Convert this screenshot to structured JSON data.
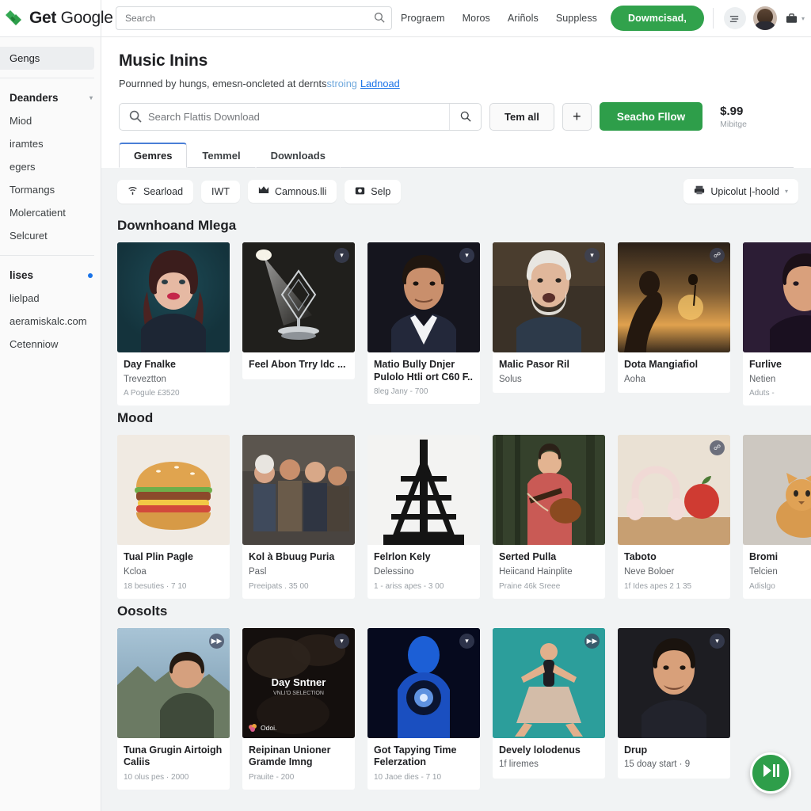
{
  "header": {
    "brand_bold": "Get",
    "brand_light": "Google",
    "logo_icon": "green-diamond-logo-icon",
    "search": {
      "placeholder": "Search",
      "value": "",
      "icon": "search-icon"
    },
    "nav": [
      {
        "label": "Prograem"
      },
      {
        "label": "Moros"
      },
      {
        "label": "Ariñols"
      },
      {
        "label": "Suppless"
      }
    ],
    "download_button": "Dowmcisad,",
    "list_icon": "lines-list-icon",
    "avatar": "user-avatar",
    "apps_icon": "briefcase-icon",
    "caret_icon": "chevron-down-icon"
  },
  "sidebar": {
    "active_item": "Gengs",
    "groups": [
      {
        "title": "Deanders",
        "caret": "chevron-down-icon",
        "items": [
          "Miod",
          "iramtes",
          "egers",
          "Tormangs",
          "Molercatient",
          "Selcuret"
        ]
      },
      {
        "title": "lises",
        "badge": "blue-dot",
        "items": [
          "lielpad",
          "aeramiskalc.com",
          "Cetenniow"
        ]
      }
    ]
  },
  "page": {
    "title": "Music Inins",
    "subtitle_plain": "Pournned by hungs, emesn-oncleted at dernts",
    "subtitle_muted": "stroing",
    "subtitle_link": "Ladnoad",
    "search": {
      "placeholder": "Search Flattis Download",
      "value": "",
      "icon": "search-icon",
      "submit_icon": "search-icon"
    },
    "btn_tem_all": "Tem all",
    "btn_plus": "+",
    "btn_green": "Seacho Fllow",
    "price": "$.99",
    "price_sub": "Mibitge",
    "tabs": [
      {
        "label": "Gemres",
        "active": true
      },
      {
        "label": "Temmel",
        "active": false
      },
      {
        "label": "Downloads",
        "active": false
      }
    ]
  },
  "chips": [
    {
      "label": "Searload",
      "icon": "wifi-icon"
    },
    {
      "label": "IWT",
      "icon": "none"
    },
    {
      "label": "Camnous.lli",
      "icon": "crown-icon"
    },
    {
      "label": "Selp",
      "icon": "camera-icon"
    }
  ],
  "chip_right": {
    "label": "Upicolut |-hoold",
    "icon": "printer-icon",
    "caret": "chevron-down-icon"
  },
  "sections": [
    {
      "title": "Downhoand Mlega",
      "cards": [
        {
          "title": "Day Fnalke",
          "sub": "Treveztton",
          "stat": "A Pogule £3520",
          "badge": "",
          "art": "portrait-woman",
          "metaw": 142
        },
        {
          "title": "Feel Abon Trry ldc ...",
          "sub": "",
          "stat": "",
          "badge": "chevron-down-icon",
          "art": "trophy-spotlight",
          "metaw": 142
        },
        {
          "title": "Matio Bully Dnjer Pulolo Htli ort C60 F..",
          "sub": "",
          "stat": "8leg Jany - 700",
          "badge": "chevron-down-icon",
          "art": "portrait-man-suit",
          "metaw": 142
        },
        {
          "title": "Malic Pasor Ril",
          "sub": "Solus",
          "stat": "",
          "badge": "chevron-down-icon",
          "art": "portrait-old-man",
          "metaw": 142
        },
        {
          "title": "Dota Mangiafiol",
          "sub": "Aoha",
          "stat": "",
          "badge": "link-icon",
          "art": "sunset-silhouette",
          "metaw": 142
        },
        {
          "title": "Furlive",
          "sub": "Netien",
          "stat": "Aduts -",
          "badge": "",
          "art": "portrait-purple",
          "metaw": 142
        }
      ]
    },
    {
      "title": "Mood",
      "cards": [
        {
          "title": "Tual Plin Pagle",
          "sub": "Kcloa",
          "stat": "18 besuties · 7 10",
          "badge": "",
          "art": "burger",
          "metaw": 142
        },
        {
          "title": "Kol à Bbuug Puria",
          "sub": "Pasl",
          "stat": "Preeipats . 35 00",
          "badge": "",
          "art": "group-friends",
          "metaw": 142
        },
        {
          "title": "Felrlon Kely",
          "sub": "Delessino",
          "stat": "1 - ariss apes - 3 00",
          "badge": "",
          "art": "tower-silhouette",
          "metaw": 142
        },
        {
          "title": "Serted Pulla",
          "sub": "Heiicand Hainplite",
          "stat": "Praine 46k Sreee",
          "badge": "",
          "art": "guitarist-forest",
          "metaw": 142
        },
        {
          "title": "Taboto",
          "sub": "Neve Boloer",
          "stat": "1f Ides apes 2 1 35",
          "badge": "link-icon",
          "art": "headphones-apple",
          "metaw": 142
        },
        {
          "title": "Bromi",
          "sub": "Telcien",
          "stat": "Adislgo",
          "badge": "",
          "art": "cat-wall",
          "metaw": 142
        }
      ]
    },
    {
      "title": "Oosolts",
      "cards": [
        {
          "title": "Tuna Grugin Airtoigh Caliis",
          "sub": "",
          "stat": "10 olus pes · 2000",
          "badge": "play-forward-icon",
          "art": "man-mountain",
          "metaw": 142
        },
        {
          "title": "Reipinan Unioner Gramde Imng",
          "sub": "",
          "stat": "Prauite - 200",
          "badge": "chevron-down-icon",
          "art": "smoke-dark",
          "overlay1": "Day Sntner",
          "overlay2": "VNLI'O SELECTION",
          "corner": "Odoi.",
          "metaw": 142
        },
        {
          "title": "Got Tapying Time Felerzation",
          "sub": "",
          "stat": "10 Jaoe dies - 7 10",
          "badge": "chevron-down-icon",
          "art": "blue-orb",
          "metaw": 142
        },
        {
          "title": "Devely lolodenus",
          "sub": "1f liremes",
          "stat": "",
          "badge": "fast-forward-icon",
          "art": "dancer-teal",
          "metaw": 142
        },
        {
          "title": "Drup",
          "sub": "15 doay start · 9",
          "stat": "",
          "badge": "chevron-down-icon",
          "art": "portrait-man-dark",
          "metaw": 142
        }
      ]
    }
  ],
  "fab": {
    "icon": "play-pause-icon",
    "label": "▶❘❘"
  },
  "colors": {
    "green": "#2e9e4a",
    "link": "#1a73e8",
    "bg": "#f1f3f4"
  }
}
